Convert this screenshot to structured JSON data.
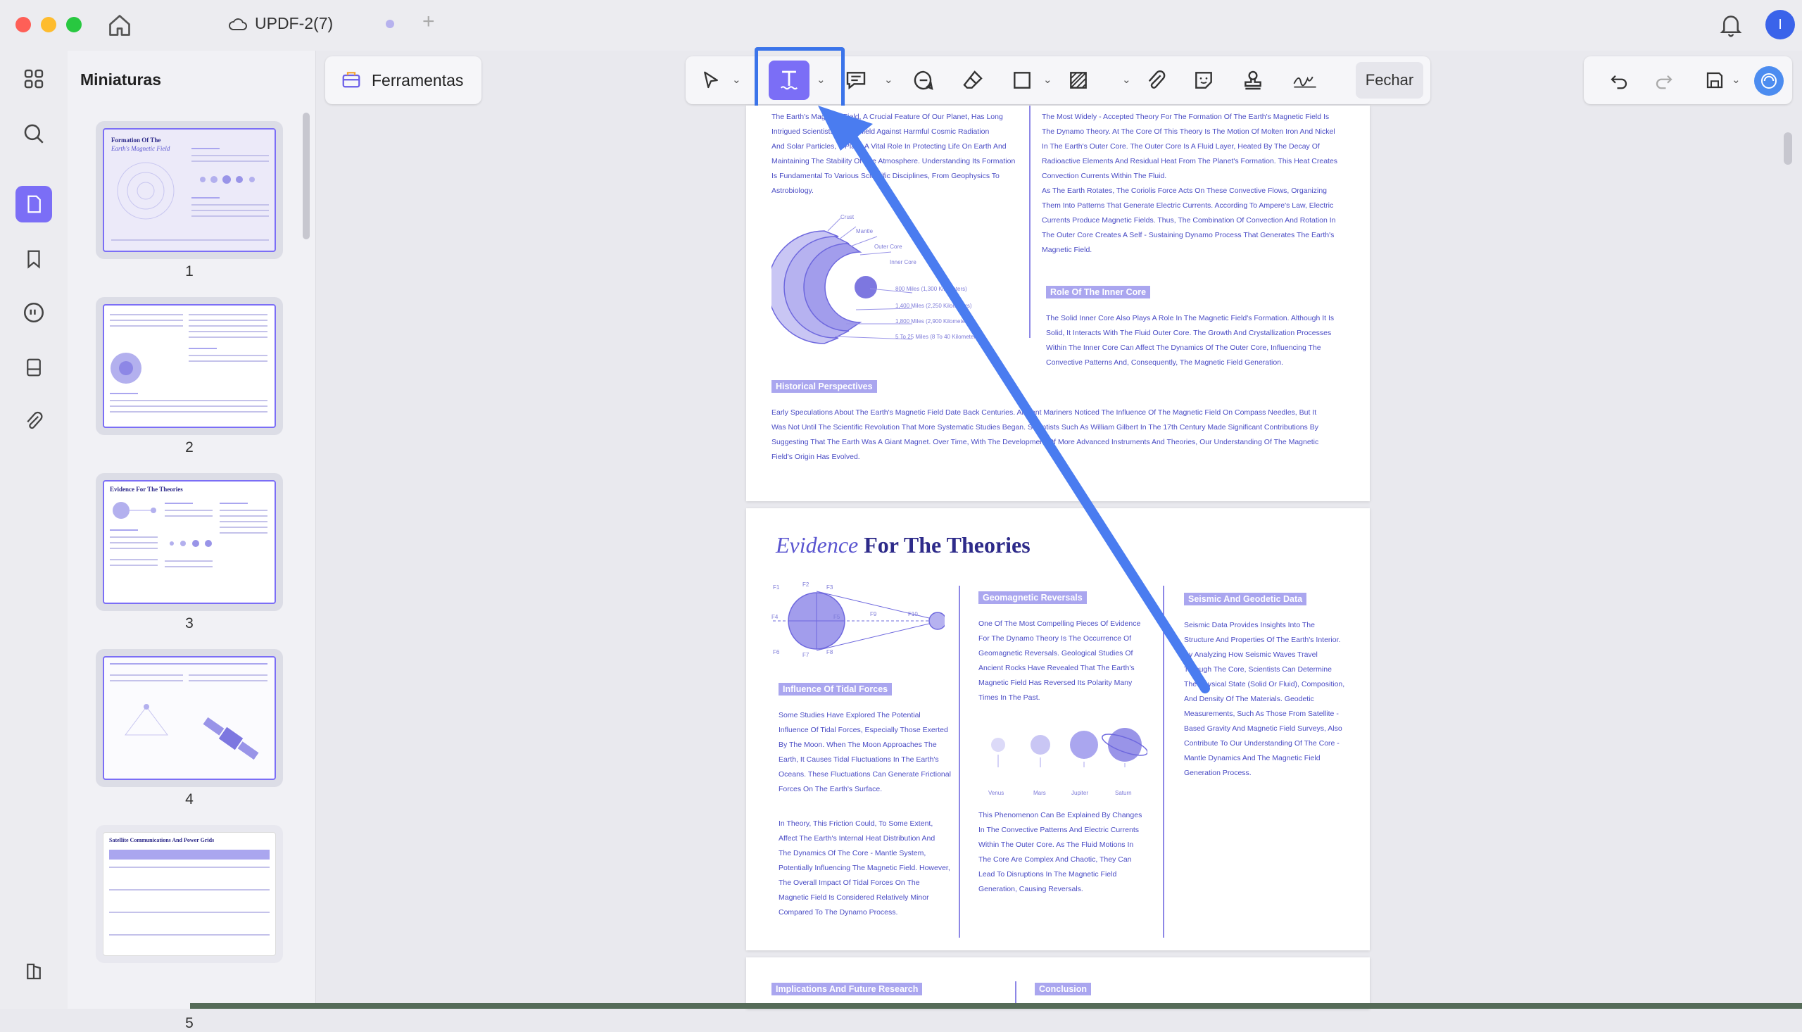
{
  "window": {
    "tab_title": "UPDF-2(7)",
    "new_tab": "+",
    "avatar_initial": "I"
  },
  "thumbnails": {
    "title": "Miniaturas",
    "pages": [
      "1",
      "2",
      "3",
      "4",
      "5"
    ],
    "page1_lines": [
      "Formation Of The",
      "Earth's Magnetic Field"
    ],
    "page3_title": "Evidence For The Theories",
    "page5_title": "Satellite Communications And Power Grids"
  },
  "toolbar": {
    "tools_label": "Ferramentas",
    "close_label": "Fechar"
  },
  "page2": {
    "col1_intro": [
      "The Earth's Magnetic Field, A Crucial Feature Of Our Planet, Has Long",
      "Intrigued Scientists. As A Shield Against Harmful Cosmic Radiation",
      "And Solar Particles, It Plays A Vital Role In Protecting Life On Earth And",
      "Maintaining The Stability Of The Atmosphere. Understanding Its Formation",
      "Is Fundamental To Various Scientific Disciplines, From Geophysics To",
      "Astrobiology."
    ],
    "diagram_labels": [
      "Crust",
      "Mantle",
      "Outer Core",
      "Inner Core",
      "800 Miles (1,300 Kilometers)",
      "1,400 Miles (2,250 Kilometers)",
      "1,800 Miles (2,900 Kilometers)",
      "5 To 25 Miles (8 To 40 Kilometers)"
    ],
    "col2_intro": [
      "The Most Widely - Accepted Theory For The Formation Of The Earth's Magnetic Field Is",
      "The Dynamo Theory. At The Core Of This Theory Is The Motion Of Molten Iron And Nickel",
      "In The Earth's Outer Core. The Outer Core Is A Fluid Layer, Heated By The Decay Of",
      "Radioactive Elements And Residual Heat From The Planet's Formation. This Heat Creates",
      "Convection Currents Within The Fluid.",
      "As The Earth Rotates, The Coriolis Force Acts On These Convective Flows, Organizing",
      "Them Into Patterns That Generate Electric Currents. According To Ampere's Law, Electric",
      "Currents Produce Magnetic Fields. Thus, The Combination Of Convection And Rotation In",
      "The Outer Core Creates A Self - Sustaining Dynamo Process That Generates The Earth's",
      "Magnetic Field."
    ],
    "inner_core_title": "Role Of The Inner Core",
    "inner_core_text": [
      "The Solid Inner Core Also Plays A Role In The Magnetic Field's Formation. Although It Is",
      "Solid, It Interacts With The Fluid Outer Core. The Growth And Crystallization Processes",
      "Within The Inner Core Can Affect The Dynamics Of The Outer Core, Influencing The",
      "Convective Patterns And, Consequently, The Magnetic Field Generation."
    ],
    "historical_title": "Historical Perspectives",
    "historical_text": [
      "Early Speculations About The Earth's Magnetic Field Date Back Centuries. Ancient Mariners Noticed The Influence Of The Magnetic Field On Compass Needles, But It",
      "Was Not Until The Scientific Revolution That More Systematic Studies Began. Scientists Such As William Gilbert In The 17th Century Made Significant Contributions By",
      "Suggesting That The Earth Was A Giant Magnet. Over Time, With The Development Of More Advanced Instruments And Theories, Our Understanding Of The Magnetic",
      "Field's Origin Has Evolved."
    ]
  },
  "page3": {
    "title_italic": "Evidence",
    "title_rest": " For The Theories",
    "tidal_title": "Influence Of Tidal Forces",
    "tidal_text": [
      "Some Studies Have Explored The Potential",
      "Influence Of Tidal Forces, Especially Those Exerted",
      "By The Moon. When The Moon Approaches The",
      "Earth, It Causes Tidal Fluctuations In The Earth's",
      "Oceans. These Fluctuations Can Generate Frictional",
      "Forces On The Earth's Surface."
    ],
    "tidal_text2": [
      "In Theory, This Friction Could, To Some Extent,",
      "Affect The Earth's Internal Heat Distribution And",
      "The Dynamics Of The Core - Mantle System,",
      "Potentially Influencing The Magnetic Field. However,",
      "The Overall Impact Of Tidal Forces On The",
      "Magnetic Field Is Considered Relatively Minor",
      "Compared To The Dynamo Process."
    ],
    "geo_title": "Geomagnetic Reversals",
    "geo_text": [
      "One Of The Most Compelling Pieces Of Evidence",
      "For The Dynamo Theory Is The Occurrence Of",
      "Geomagnetic Reversals. Geological Studies Of",
      "Ancient Rocks Have Revealed That The Earth's",
      "Magnetic Field Has Reversed Its Polarity Many",
      "Times In The Past."
    ],
    "planets": [
      "Venus",
      "Mars",
      "Jupiter",
      "Saturn"
    ],
    "geo_text2": [
      "This Phenomenon Can Be Explained By Changes",
      "In The Convective Patterns And Electric Currents",
      "Within The Outer Core. As The Fluid Motions In",
      "The Core Are Complex And Chaotic, They Can",
      "Lead To Disruptions In The Magnetic Field",
      "Generation, Causing Reversals."
    ],
    "seismic_title": "Seismic And Geodetic Data",
    "seismic_text": [
      "Seismic Data Provides Insights Into The",
      "Structure And Properties Of The Earth's Interior.",
      "By Analyzing How Seismic Waves Travel",
      "Through The Core, Scientists Can Determine",
      "The Physical State (Solid Or Fluid), Composition,",
      "And Density Of The Materials. Geodetic",
      "Measurements, Such As Those From Satellite -",
      "Based Gravity And Magnetic Field Surveys, Also",
      "Contribute To Our Understanding Of The Core -",
      "Mantle Dynamics And The Magnetic Field",
      "Generation Process."
    ],
    "tidal_diagram_labels": [
      "F1",
      "F2",
      "F3",
      "F4",
      "F5",
      "F6",
      "F7",
      "F8",
      "F9",
      "F10"
    ]
  },
  "page4": {
    "labels": [
      "Implications And Future Research",
      "Conclusion"
    ]
  },
  "colors": {
    "accent": "#7b6ef6",
    "highlight": "#3b74ea",
    "arrow": "#4a7cf0",
    "text": "#4a4cc4"
  },
  "icons": [
    "home-icon",
    "cloud-icon",
    "bell-icon",
    "grid-icon",
    "search-icon",
    "pages-icon",
    "bookmark-icon",
    "comment-icon",
    "form-icon",
    "attachment-icon",
    "layers-icon",
    "select-arrow-icon",
    "text-icon",
    "text-comment-icon",
    "note-icon",
    "eraser-icon",
    "rectangle-icon",
    "hatch-icon",
    "paperclip-icon",
    "sticker-icon",
    "stamp-icon",
    "signature-icon",
    "undo-icon",
    "redo-icon",
    "save-icon",
    "ai-assistant-icon"
  ]
}
